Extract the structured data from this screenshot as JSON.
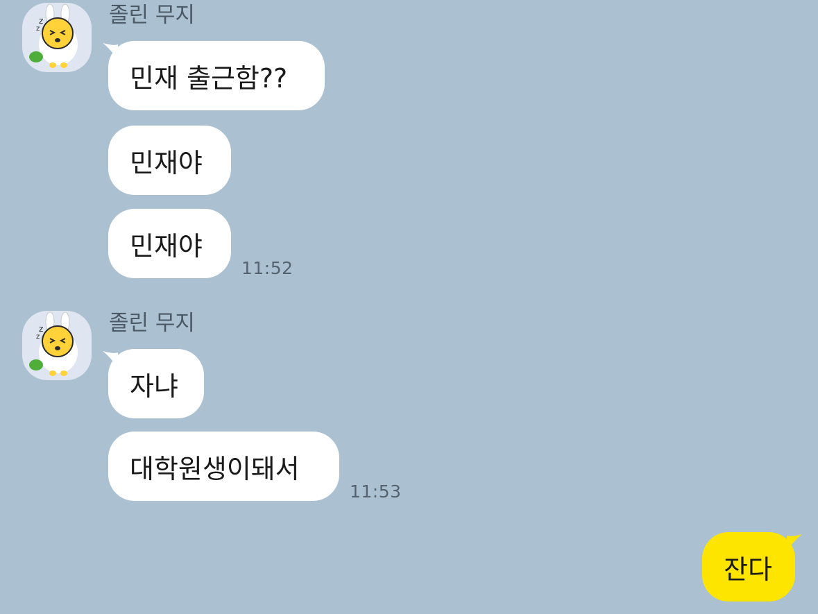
{
  "chat": {
    "groups": [
      {
        "sender": "졸린 무지",
        "avatar_icon": "muzi-bunny-avatar-icon",
        "messages": [
          "민재 출근함??",
          "민재야",
          "민재야"
        ],
        "time": "11:52"
      },
      {
        "sender": "졸린 무지",
        "avatar_icon": "muzi-bunny-avatar-icon",
        "messages": [
          "자냐",
          "대학원생이돼서"
        ],
        "time": "11:53"
      }
    ],
    "my_messages": [
      "잔다"
    ]
  },
  "colors": {
    "background": "#abc1d1",
    "incoming_bubble": "#ffffff",
    "outgoing_bubble": "#fee500"
  }
}
